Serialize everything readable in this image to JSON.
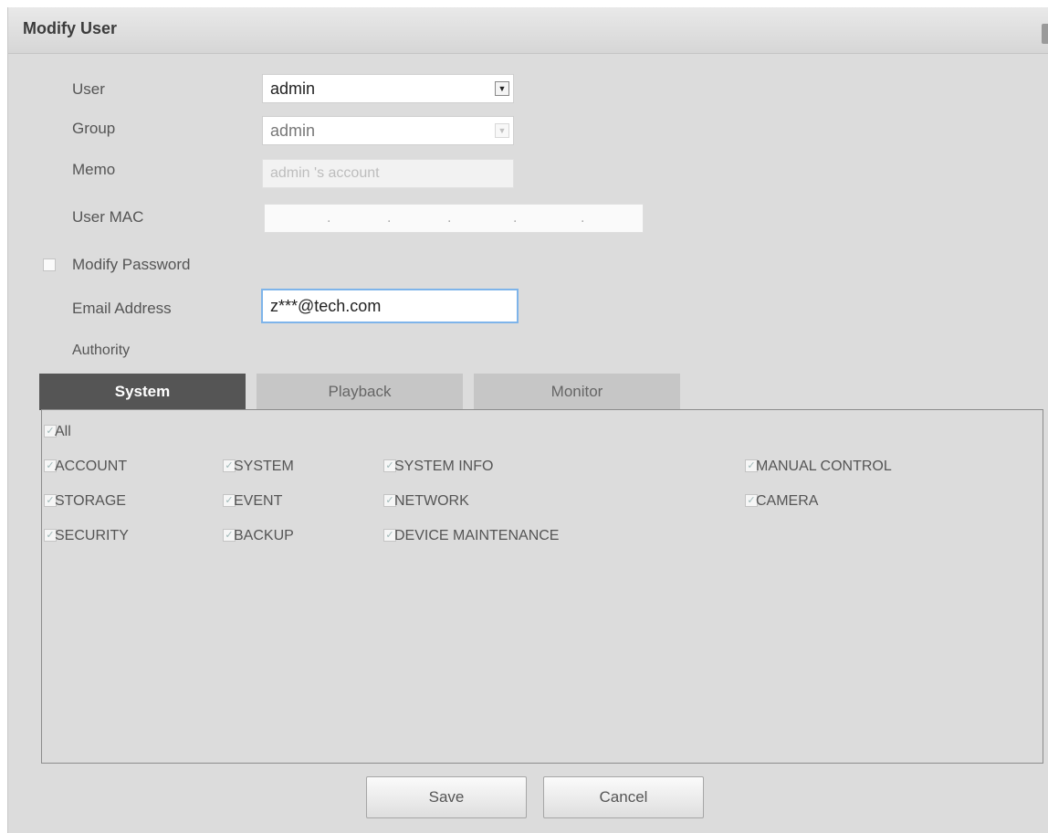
{
  "dialog": {
    "title": "Modify User"
  },
  "form": {
    "user_label": "User",
    "user_value": "admin",
    "group_label": "Group",
    "group_value": "admin",
    "memo_label": "Memo",
    "memo_value": "admin 's account",
    "mac_label": "User MAC",
    "mac_separators": [
      ".",
      ".",
      ".",
      ".",
      "."
    ],
    "modify_password_label": "Modify Password",
    "modify_password_checked": false,
    "email_label": "Email Address",
    "email_value": "z***@tech.com",
    "authority_label": "Authority"
  },
  "tabs": [
    {
      "label": "System",
      "active": true
    },
    {
      "label": "Playback",
      "active": false
    },
    {
      "label": "Monitor",
      "active": false
    }
  ],
  "permissions": {
    "all_label": "All",
    "all_checked": true,
    "items": [
      {
        "label": "ACCOUNT",
        "checked": true
      },
      {
        "label": "SYSTEM",
        "checked": true
      },
      {
        "label": "SYSTEM INFO",
        "checked": true
      },
      {
        "label": "MANUAL CONTROL",
        "checked": true
      },
      {
        "label": "STORAGE",
        "checked": true
      },
      {
        "label": "EVENT",
        "checked": true
      },
      {
        "label": "NETWORK",
        "checked": true
      },
      {
        "label": "CAMERA",
        "checked": true
      },
      {
        "label": "SECURITY",
        "checked": true
      },
      {
        "label": "BACKUP",
        "checked": true
      },
      {
        "label": "DEVICE MAINTENANCE",
        "checked": true
      }
    ]
  },
  "buttons": {
    "save_label": "Save",
    "cancel_label": "Cancel"
  },
  "icons": {
    "dropdown": "chevron-down-icon",
    "checkbox": "checkmark-icon"
  },
  "colors": {
    "active_tab": "#555555",
    "inactive_tab": "#c6c6c6",
    "email_focus_border": "#7eb4ea",
    "dialog_bg": "#dcdcdc"
  }
}
